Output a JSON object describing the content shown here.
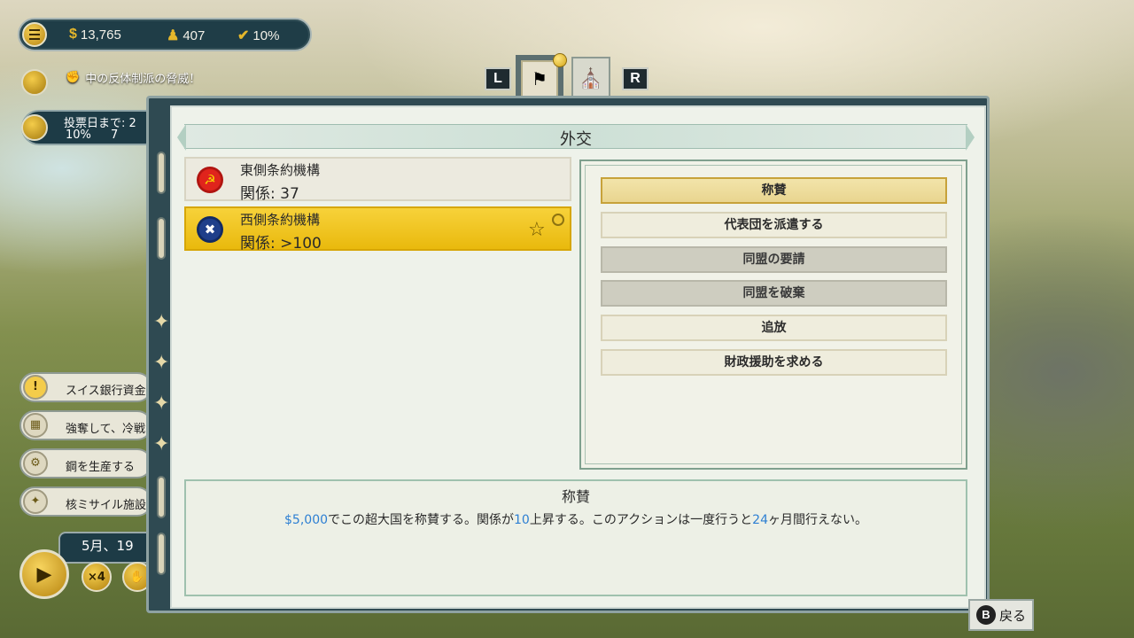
{
  "hud": {
    "money": "13,765",
    "population": "407",
    "approval": "10%",
    "money_icon": "$"
  },
  "toast": {
    "text": "中の反体制派の脅威！"
  },
  "election": {
    "line1": "投票日まで: 2",
    "line2_pct": "10%",
    "line2_rest": "7"
  },
  "missions": [
    {
      "label": "スイス銀行資金"
    },
    {
      "label": "強奪して、冷戦"
    },
    {
      "label": "鋼を生産する"
    },
    {
      "label": "核ミサイル施設"
    }
  ],
  "time": {
    "date": "5月、19",
    "speed_label": "×4"
  },
  "tabs": {
    "left_key": "L",
    "right_key": "R"
  },
  "panel": {
    "title": "外交"
  },
  "blocs": [
    {
      "name": "東側条約機構",
      "relation": "関係: 37"
    },
    {
      "name": "西側条約機構",
      "relation": "関係: >100"
    }
  ],
  "actions": [
    {
      "label": "称賛",
      "state": "highlighted"
    },
    {
      "label": "代表団を派遣する",
      "state": "enabled"
    },
    {
      "label": "同盟の要請",
      "state": "disabled"
    },
    {
      "label": "同盟を破棄",
      "state": "disabled"
    },
    {
      "label": "追放",
      "state": "enabled"
    },
    {
      "label": "財政援助を求める",
      "state": "enabled"
    }
  ],
  "description": {
    "title": "称賛",
    "cost": "$5,000",
    "part1": "でこの超大国を称賛する。関係が",
    "gain": "10",
    "part2": "上昇する。このアクションは一度行うと",
    "months": "24",
    "part3": "ヶ月間行えない。"
  },
  "back": {
    "key": "B",
    "label": "戻る"
  },
  "colors": {
    "accent_gold": "#e9b90d",
    "highlight_blue": "#2d7fd3",
    "panel_frame": "#2f4a52"
  }
}
